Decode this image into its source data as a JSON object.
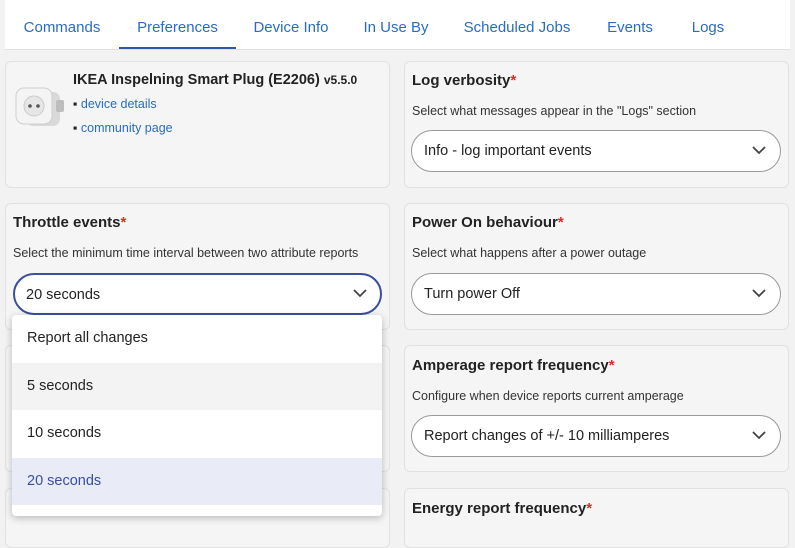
{
  "tabs": [
    "Commands",
    "Preferences",
    "Device Info",
    "In Use By",
    "Scheduled Jobs",
    "Events",
    "Logs"
  ],
  "active_tab": "Preferences",
  "device": {
    "name": "IKEA Inspelning Smart Plug (E2206)",
    "version": "v5.5.0",
    "links": [
      "device details",
      "community page"
    ]
  },
  "log_verbosity": {
    "title": "Log verbosity",
    "required_mark": "*",
    "description": "Select what messages appear in the \"Logs\" section",
    "value": "Info - log important events"
  },
  "throttle": {
    "title": "Throttle events",
    "required_mark": "*",
    "description": "Select the minimum time interval between two attribute reports",
    "value": "20 seconds",
    "options": [
      "Report all changes",
      "5 seconds",
      "10 seconds",
      "20 seconds"
    ]
  },
  "power_on": {
    "title": "Power On behaviour",
    "required_mark": "*",
    "description": "Select what happens after a power outage",
    "value": "Turn power Off"
  },
  "amperage": {
    "title": "Amperage report frequency",
    "required_mark": "*",
    "description": "Configure when device reports current amperage",
    "value": "Report changes of +/- 10 milliamperes"
  },
  "energy": {
    "title": "Energy report frequency",
    "required_mark": "*"
  }
}
